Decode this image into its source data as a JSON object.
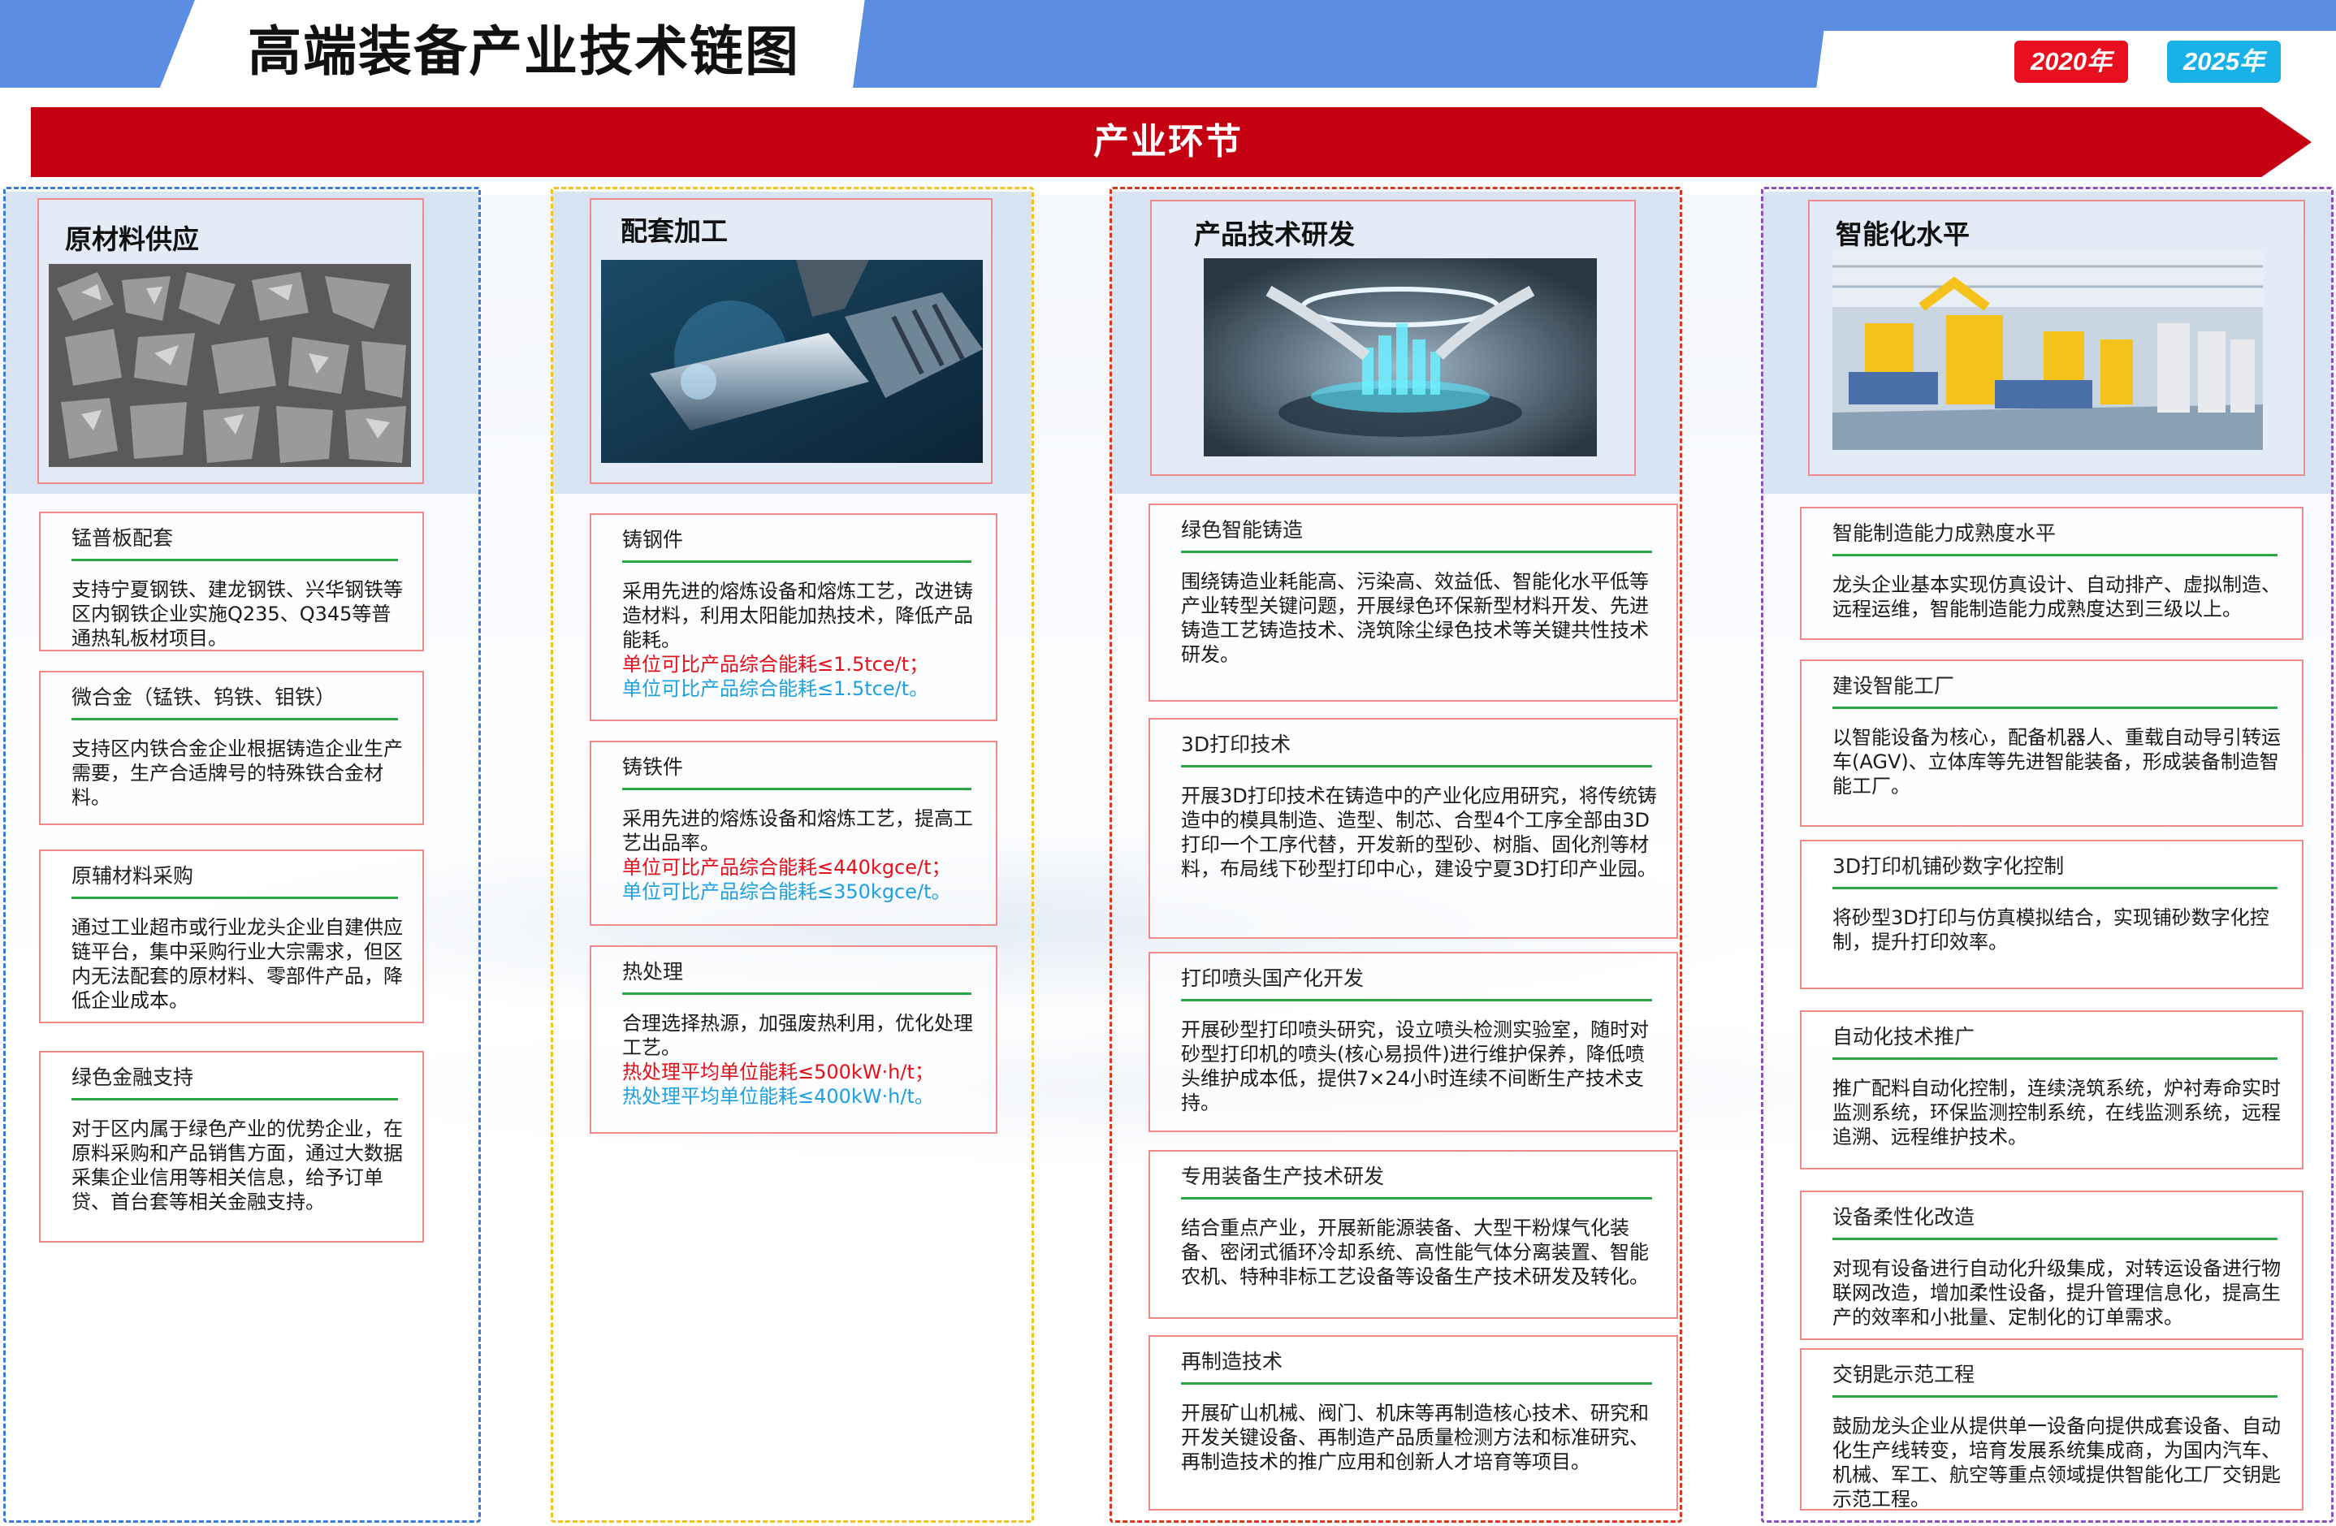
{
  "header": {
    "title": "高端装备产业技术链图",
    "year_2020": "2020年",
    "year_2025": "2025年"
  },
  "banner": {
    "label": "产业环节"
  },
  "colors": {
    "header_blue": "#5b8ee0",
    "banner_red": "#c50012",
    "badge_red": "#e8101e",
    "badge_blue": "#18b2e8",
    "col1_border": "#3a7ad8",
    "col2_border": "#f2c21c",
    "col3_border": "#d9381e",
    "col4_border": "#8a50c0",
    "card_border": "#f08a8a",
    "rule_green": "#27a845"
  },
  "columns": [
    {
      "title": "原材料供应",
      "photo": "metal-ore-photo",
      "cards": [
        {
          "title": "锰普板配套",
          "body": "支持宁夏钢铁、建龙钢铁、兴华钢铁等区内钢铁企业实施Q235、Q345等普通热轧板材项目。"
        },
        {
          "title": "微合金（锰铁、钨铁、钼铁）",
          "body": "支持区内铁合金企业根据铸造企业生产需要，生产合适牌号的特殊铁合金材料。"
        },
        {
          "title": "原辅材料采购",
          "body": "通过工业超市或行业龙头企业自建供应链平台，集中采购行业大宗需求，但区内无法配套的原材料、零部件产品，降低企业成本。"
        },
        {
          "title": "绿色金融支持",
          "body": "对于区内属于绿色产业的优势企业，在原料采购和产品销售方面，通过大数据采集企业信用等相关信息，给予订单贷、首台套等相关金融支持。"
        }
      ]
    },
    {
      "title": "配套加工",
      "photo": "cnc-machining-photo",
      "cards": [
        {
          "title": "铸钢件",
          "body": "采用先进的熔炼设备和熔炼工艺，改进铸造材料，利用太阳能加热技术，降低产品能耗。",
          "red": "单位可比产品综合能耗≤1.5tce/t；",
          "blue": "单位可比产品综合能耗≤1.5tce/t。"
        },
        {
          "title": "铸铁件",
          "body": "采用先进的熔炼设备和熔炼工艺，提高工艺出品率。",
          "red": "单位可比产品综合能耗≤440kgce/t；",
          "blue": "单位可比产品综合能耗≤350kgce/t。"
        },
        {
          "title": "热处理",
          "body": "合理选择热源，加强废热利用，优化处理工艺。",
          "red": "热处理平均单位能耗≤500kW·h/t；",
          "blue": "热处理平均单位能耗≤400kW·h/t。"
        }
      ]
    },
    {
      "title": "产品技术研发",
      "photo": "tech-lab-photo",
      "cards": [
        {
          "title": "绿色智能铸造",
          "body": "围绕铸造业耗能高、污染高、效益低、智能化水平低等产业转型关键问题，开展绿色环保新型材料开发、先进铸造工艺铸造技术、浇筑除尘绿色技术等关键共性技术研发。"
        },
        {
          "title": "3D打印技术",
          "body": "开展3D打印技术在铸造中的产业化应用研究，将传统铸造中的模具制造、造型、制芯、合型4个工序全部由3D打印一个工序代替，开发新的型砂、树脂、固化剂等材料，布局线下砂型打印中心，建设宁夏3D打印产业园。"
        },
        {
          "title": "打印喷头国产化开发",
          "body": "开展砂型打印喷头研究，设立喷头检测实验室，随时对砂型打印机的喷头(核心易损件)进行维护保养，降低喷头维护成本低，提供7×24小时连续不间断生产技术支持。"
        },
        {
          "title": "专用装备生产技术研发",
          "body": "结合重点产业，开展新能源装备、大型干粉煤气化装备、密闭式循环冷却系统、高性能气体分离装置、智能农机、特种非标工艺设备等设备生产技术研发及转化。"
        },
        {
          "title": "再制造技术",
          "body": "开展矿山机械、阀门、机床等再制造核心技术、研究和开发关键设备、再制造产品质量检测方法和标准研究、再制造技术的推广应用和创新人才培育等项目。"
        }
      ]
    },
    {
      "title": "智能化水平",
      "photo": "robot-factory-photo",
      "cards": [
        {
          "title": "智能制造能力成熟度水平",
          "body": "龙头企业基本实现仿真设计、自动排产、虚拟制造、远程运维，智能制造能力成熟度达到三级以上。"
        },
        {
          "title": "建设智能工厂",
          "body": "以智能设备为核心，配备机器人、重载自动导引转运车(AGV)、立体库等先进智能装备，形成装备制造智能工厂。"
        },
        {
          "title": "3D打印机铺砂数字化控制",
          "body": "将砂型3D打印与仿真模拟结合，实现铺砂数字化控制，提升打印效率。"
        },
        {
          "title": "自动化技术推广",
          "body": "推广配料自动化控制，连续浇筑系统，炉衬寿命实时监测系统，环保监测控制系统，在线监测系统，远程追溯、远程维护技术。"
        },
        {
          "title": "设备柔性化改造",
          "body": "对现有设备进行自动化升级集成，对转运设备进行物联网改造，增加柔性设备，提升管理信息化，提高生产的效率和小批量、定制化的订单需求。"
        },
        {
          "title": "交钥匙示范工程",
          "body": "鼓励龙头企业从提供单一设备向提供成套设备、自动化生产线转变，培育发展系统集成商，为国内汽车、机械、军工、航空等重点领域提供智能化工厂交钥匙示范工程。"
        }
      ]
    }
  ]
}
